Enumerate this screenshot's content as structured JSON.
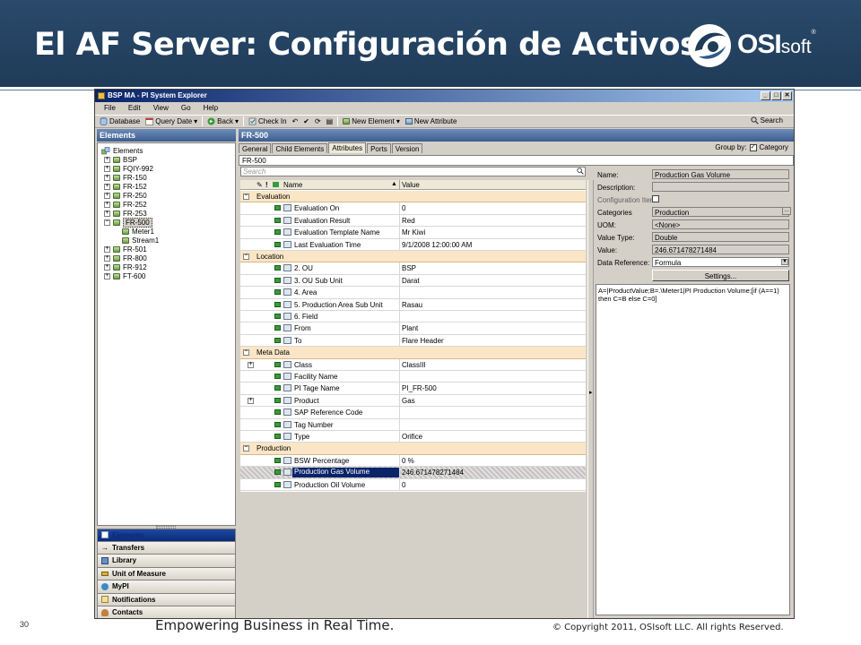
{
  "slide": {
    "title": "El AF Server: Configuración de Activos",
    "logo_big": "OSI",
    "logo_small": "soft",
    "logo_mark": "®",
    "page_number": "30",
    "tagline": "Empowering Business in Real Time.",
    "copyright": "© Copyright 2011, OSIsoft LLC.  All rights Reserved.",
    "colors": {
      "header_bg": "#1f3b58",
      "accent": "#3d5d8f"
    }
  },
  "window": {
    "title": "BSP MA - PI System Explorer",
    "buttons": [
      "_",
      "□",
      "✕"
    ],
    "menu": [
      "File",
      "Edit",
      "View",
      "Go",
      "Help"
    ],
    "toolbar": {
      "database": "Database",
      "query_date": "Query Date",
      "back": "Back",
      "check_in": "Check In",
      "new_element": "New Element",
      "new_attribute": "New Attribute",
      "search": "Search"
    }
  },
  "left": {
    "header": "Elements",
    "tree": [
      {
        "label": "Elements",
        "level": 0,
        "expander": ""
      },
      {
        "label": "BSP",
        "level": 1,
        "expander": "+"
      },
      {
        "label": "FQIY-992",
        "level": 1,
        "expander": "+"
      },
      {
        "label": "FR-150",
        "level": 1,
        "expander": "+"
      },
      {
        "label": "FR-152",
        "level": 1,
        "expander": "+"
      },
      {
        "label": "FR-250",
        "level": 1,
        "expander": "+"
      },
      {
        "label": "FR-252",
        "level": 1,
        "expander": "+"
      },
      {
        "label": "FR-253",
        "level": 1,
        "expander": "+"
      },
      {
        "label": "FR-500",
        "level": 1,
        "expander": "−",
        "selected": true
      },
      {
        "label": "Meter1",
        "level": 2,
        "expander": ""
      },
      {
        "label": "Stream1",
        "level": 2,
        "expander": ""
      },
      {
        "label": "FR-501",
        "level": 1,
        "expander": "+"
      },
      {
        "label": "FR-800",
        "level": 1,
        "expander": "+"
      },
      {
        "label": "FR-912",
        "level": 1,
        "expander": "+"
      },
      {
        "label": "FT-600",
        "level": 1,
        "expander": "+"
      }
    ],
    "nav": [
      {
        "label": "Elements",
        "icon": "elements-icon"
      },
      {
        "label": "Transfers",
        "icon": "transfers-icon"
      },
      {
        "label": "Library",
        "icon": "library-icon"
      },
      {
        "label": "Unit of Measure",
        "icon": "unit-of-measure-icon"
      },
      {
        "label": "MyPI",
        "icon": "mypi-icon"
      },
      {
        "label": "Notifications",
        "icon": "notifications-icon"
      },
      {
        "label": "Contacts",
        "icon": "contacts-icon"
      }
    ]
  },
  "right": {
    "header": "FR-500",
    "tabs": [
      "General",
      "Child Elements",
      "Attributes",
      "Ports",
      "Version"
    ],
    "active_tab": "Attributes",
    "group_by_label": "Group by:",
    "group_by_option": "Category",
    "group_by_check": "✓",
    "path": "FR-500",
    "search_placeholder": "Search",
    "grid_columns": {
      "name": "Name",
      "value": "Value"
    },
    "grid": [
      {
        "type": "category",
        "label": "Evaluation"
      },
      {
        "type": "attr",
        "name": "Evaluation On",
        "value": "0"
      },
      {
        "type": "attr",
        "name": "Evaluation Result",
        "value": "Red"
      },
      {
        "type": "attr",
        "name": "Evaluation Template Name",
        "value": "Mr Kiwi"
      },
      {
        "type": "attr",
        "name": "Last Evaluation Time",
        "value": "9/1/2008 12:00:00 AM"
      },
      {
        "type": "category",
        "label": "Location"
      },
      {
        "type": "attr",
        "name": "2. OU",
        "value": "BSP"
      },
      {
        "type": "attr",
        "name": "3. OU Sub Unit",
        "value": "Darat"
      },
      {
        "type": "attr",
        "name": "4. Area",
        "value": ""
      },
      {
        "type": "attr",
        "name": "5. Production Area Sub Unit",
        "value": "Rasau"
      },
      {
        "type": "attr",
        "name": "6. Field",
        "value": ""
      },
      {
        "type": "attr",
        "name": "From",
        "value": "Plant"
      },
      {
        "type": "attr",
        "name": "To",
        "value": "Flare Header"
      },
      {
        "type": "category",
        "label": "Meta Data"
      },
      {
        "type": "attr",
        "name": "Class",
        "value": "ClassIII",
        "expander": "+"
      },
      {
        "type": "attr",
        "name": "Facility Name",
        "value": ""
      },
      {
        "type": "attr",
        "name": "PI Tage Name",
        "value": "PI_FR-500"
      },
      {
        "type": "attr",
        "name": "Product",
        "value": "Gas",
        "expander": "+"
      },
      {
        "type": "attr",
        "name": "SAP Reference Code",
        "value": ""
      },
      {
        "type": "attr",
        "name": "Tag Number",
        "value": ""
      },
      {
        "type": "attr",
        "name": "Type",
        "value": "Orifice"
      },
      {
        "type": "category",
        "label": "Production"
      },
      {
        "type": "attr",
        "name": "BSW Percentage",
        "value": "0 %"
      },
      {
        "type": "attr",
        "name": "Production Gas Volume",
        "value": "246.671478271484",
        "selected": true
      },
      {
        "type": "attr",
        "name": "Production Oil Volume",
        "value": "0"
      }
    ],
    "properties": {
      "name_label": "Name:",
      "name_value": "Production Gas Volume",
      "description_label": "Description:",
      "description_value": "",
      "config_item_label": "Configuration Item:",
      "categories_label": "Categories",
      "categories_value": "Production",
      "uom_label": "UOM:",
      "uom_value": "<None>",
      "value_type_label": "Value Type:",
      "value_type_value": "Double",
      "value_label": "Value:",
      "value_value": "246.671478271484",
      "data_reference_label": "Data Reference:",
      "data_reference_value": "Formula",
      "settings_button": "Settings...",
      "formula": "A=|ProductValue;B=.\\Meter1|PI Production Volume;[if (A==1) then C=B else C=0]"
    }
  }
}
